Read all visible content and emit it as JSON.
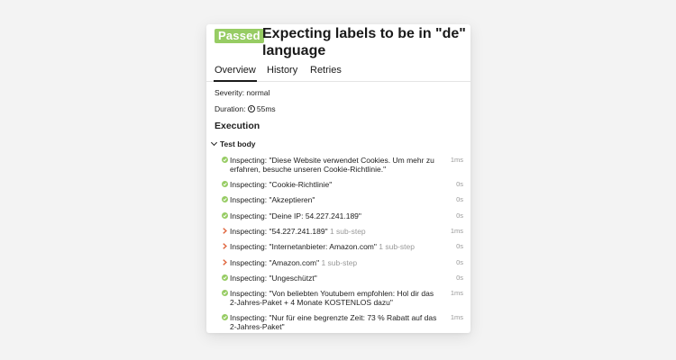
{
  "header": {
    "status": "Passed",
    "title": "Expecting labels to be in \"de\" language",
    "status_color": "#97cc64"
  },
  "tabs": [
    {
      "label": "Overview",
      "active": true
    },
    {
      "label": "History",
      "active": false
    },
    {
      "label": "Retries",
      "active": false
    }
  ],
  "meta": {
    "severity": "Severity: normal",
    "duration": "Duration: 55ms",
    "duration_icon": "clock-icon"
  },
  "execution": {
    "title": "Execution",
    "body_label": "Test body",
    "steps": [
      {
        "status": "passed",
        "icon": "check-circle-icon",
        "text": "Inspecting: \"Diese Website verwendet Cookies. Um mehr zu erfahren, besuche unseren Cookie-Richtlinie.\"",
        "substep": "",
        "duration": "1ms"
      },
      {
        "status": "passed",
        "icon": "check-circle-icon",
        "text": "Inspecting: \"Cookie-Richtlinie\"",
        "substep": "",
        "duration": "0s"
      },
      {
        "status": "passed",
        "icon": "check-circle-icon",
        "text": "Inspecting: \"Akzeptieren\"",
        "substep": "",
        "duration": "0s"
      },
      {
        "status": "passed",
        "icon": "check-circle-icon",
        "text": "Inspecting: \"Deine IP: 54.227.241.189\"",
        "substep": "",
        "duration": "0s"
      },
      {
        "status": "expandable",
        "icon": "chevron-right-icon",
        "text": "Inspecting: \"54.227.241.189\"",
        "substep": "1 sub-step",
        "duration": "1ms"
      },
      {
        "status": "expandable",
        "icon": "chevron-right-icon",
        "text": "Inspecting: \"Internetanbieter: Amazon.com\"",
        "substep": "1 sub-step",
        "duration": "0s"
      },
      {
        "status": "expandable",
        "icon": "chevron-right-icon",
        "text": "Inspecting: \"Amazon.com\"",
        "substep": "1 sub-step",
        "duration": "0s"
      },
      {
        "status": "passed",
        "icon": "check-circle-icon",
        "text": "Inspecting: \"Ungeschützt\"",
        "substep": "",
        "duration": "0s"
      },
      {
        "status": "passed",
        "icon": "check-circle-icon",
        "text": "Inspecting: \"Von beliebten Youtubern empfohlen: Hol dir das 2-Jahres-Paket + 4 Monate KOSTENLOS dazu\"",
        "substep": "",
        "duration": "1ms"
      },
      {
        "status": "passed",
        "icon": "check-circle-icon",
        "text": "Inspecting: \"Nur für eine begrenzte Zeit: 73 % Rabatt auf das 2-Jahres-Paket\"",
        "substep": "",
        "duration": "1ms"
      }
    ]
  },
  "colors": {
    "passed": "#97cc64",
    "expand": "#e0673f",
    "muted": "#999999"
  }
}
